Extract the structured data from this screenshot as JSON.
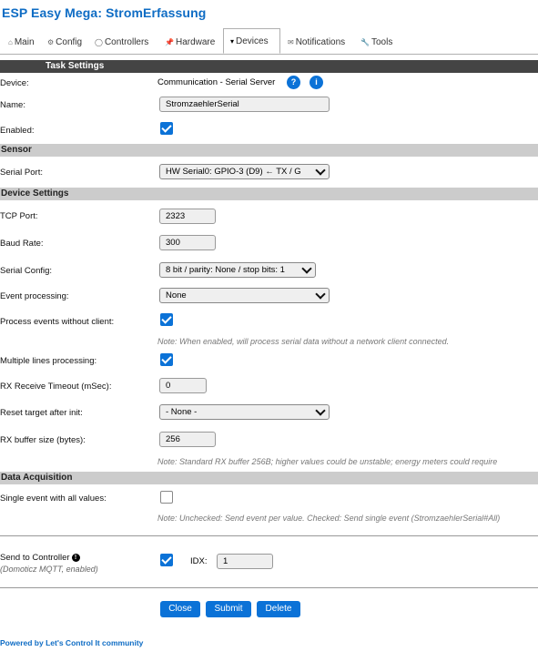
{
  "app": {
    "title": "ESP Easy Mega: StromErfassung"
  },
  "tabs": [
    {
      "icon": "⌂",
      "label": "Main"
    },
    {
      "icon": "⚙",
      "label": "Config"
    },
    {
      "icon": "◯",
      "label": "Controllers"
    },
    {
      "icon": "📌",
      "label": "Hardware"
    },
    {
      "icon": "▾",
      "label": "Devices"
    },
    {
      "icon": "✉",
      "label": "Notifications"
    },
    {
      "icon": "🔧",
      "label": "Tools"
    }
  ],
  "header": "Task Settings",
  "device": {
    "label": "Device:",
    "value": "Communication - Serial Server",
    "help1": "?",
    "help2": "i"
  },
  "name": {
    "label": "Name:",
    "value": "StromzaehlerSerial"
  },
  "enabled": {
    "label": "Enabled:",
    "checked": true
  },
  "sensor": {
    "title": "Sensor",
    "serial_port_label": "Serial Port:",
    "serial_port_value": "HW Serial0: GPIO-3 (D9) ← TX / G"
  },
  "device_settings": {
    "title": "Device Settings",
    "tcp_port_label": "TCP Port:",
    "tcp_port_value": "2323",
    "baud_label": "Baud Rate:",
    "baud_value": "300",
    "serial_config_label": "Serial Config:",
    "serial_config_value": "8 bit / parity: None / stop bits: 1",
    "event_processing_label": "Event processing:",
    "event_processing_value": "None",
    "process_events_label": "Process events without client:",
    "process_events_checked": true,
    "process_events_note": "Note: When enabled, will process serial data without a network client connected.",
    "multiple_lines_label": "Multiple lines processing:",
    "multiple_lines_checked": true,
    "rx_timeout_label": "RX Receive Timeout (mSec):",
    "rx_timeout_value": "0",
    "reset_target_label": "Reset target after init:",
    "reset_target_value": "- None -",
    "rx_buffer_label": "RX buffer size (bytes):",
    "rx_buffer_value": "256",
    "rx_buffer_note": "Note: Standard RX buffer 256B; higher values could be unstable; energy meters could require"
  },
  "data_acquisition": {
    "title": "Data Acquisition",
    "single_event_label": "Single event with all values:",
    "single_event_checked": false,
    "single_event_note": "Note: Unchecked: Send event per value. Checked: Send single event (StromzaehlerSerial#All)"
  },
  "controller": {
    "label": "Send to Controller",
    "badge": "!",
    "sub": "(Domoticz MQTT, enabled)",
    "checked": true,
    "idx_label": "IDX:",
    "idx_value": "1"
  },
  "buttons": {
    "close": "Close",
    "submit": "Submit",
    "delete": "Delete"
  },
  "footer": "Powered by Let's Control It community",
  "colors": {
    "accent": "#0b72d7",
    "header_bar": "#444444",
    "section_bar": "#cccccc",
    "title": "#0e6cc4"
  }
}
